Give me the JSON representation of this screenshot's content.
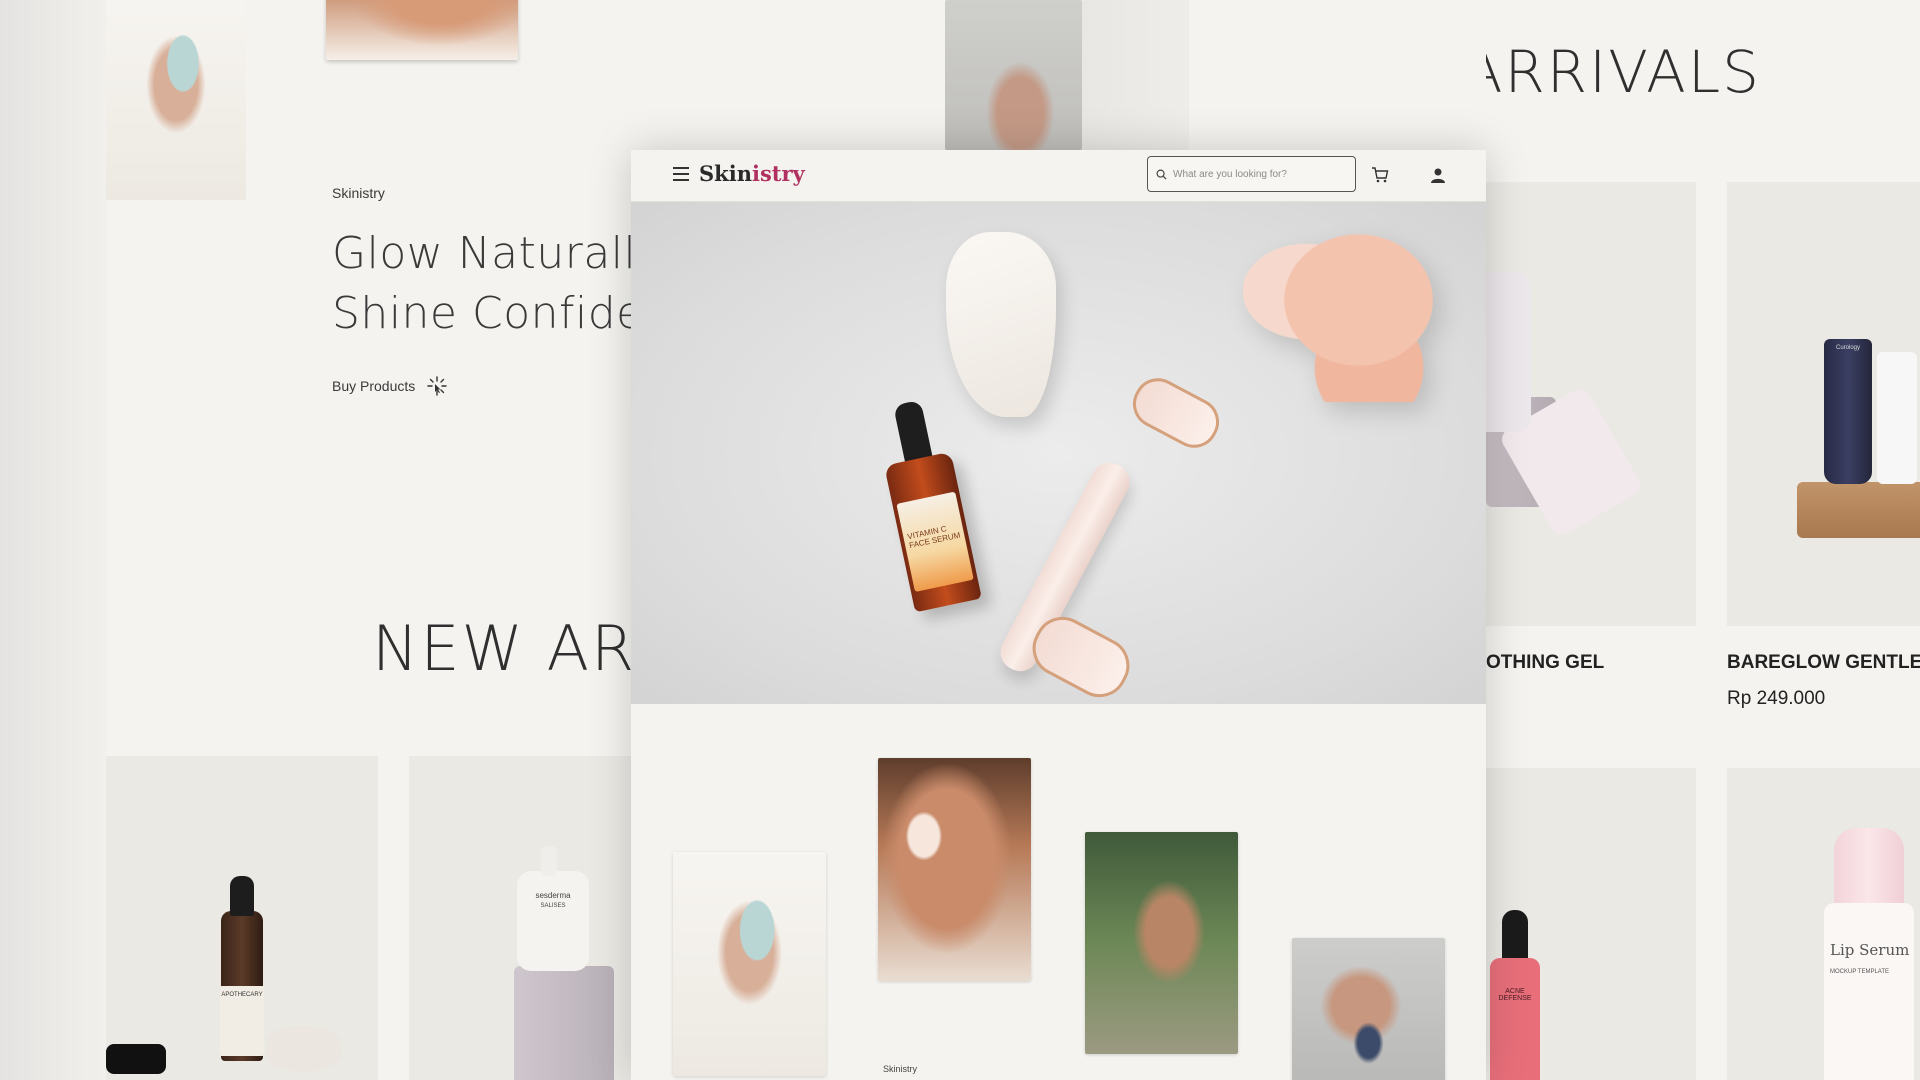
{
  "background": {
    "brand_label": "Skinistry",
    "hero_line_1": "Glow Naturall",
    "hero_line_2": "Shine Confide",
    "buy_label": "Buy Products",
    "section_title_top": "NEW ARRIVALS",
    "section_title_mid": "NEW ARR"
  },
  "products": [
    {
      "name": "OTHING GEL",
      "price": ""
    },
    {
      "name": "BAREGLOW GENTLE",
      "price": "Rp 249.000"
    }
  ],
  "product_labels": {
    "lip_serum": "Lip Serum",
    "lip_serum_sub": "MOCKUP TEMPLATE",
    "acne": "ACNE DEFENSE",
    "sesderma": "sesderma",
    "sesderma_sub": "SALISES",
    "apothecary": "APOTHECARY",
    "curology": "Curology"
  },
  "window": {
    "logo_main": "Skin",
    "logo_accent": "istry",
    "search_placeholder": "What are you looking for?",
    "gallery_caption": "Skinistry",
    "hero_bottle_label": "VITAMIN C FACE SERUM"
  },
  "icons": [
    "menu-icon",
    "search-icon",
    "cart-icon",
    "user-icon",
    "sparkle-icon"
  ],
  "colors": {
    "page_bg": "#f4f3ef",
    "logo_accent": "#b03060",
    "text": "#2b2b2b"
  }
}
